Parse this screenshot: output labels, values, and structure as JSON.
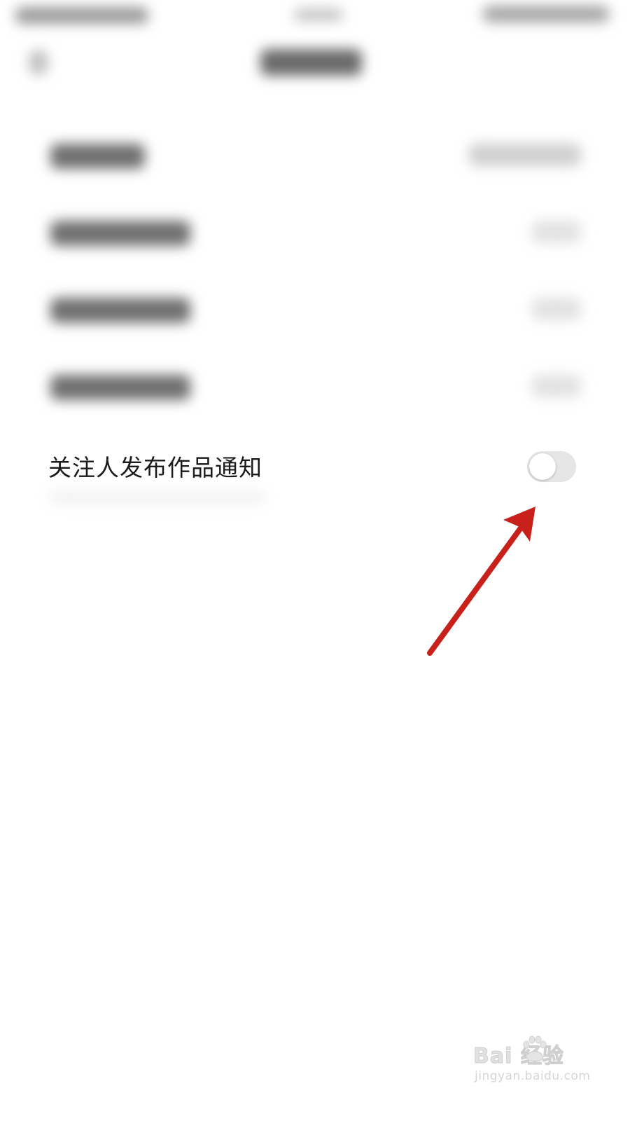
{
  "settings": {
    "follow_post_notify": {
      "label": "关注人发布作品通知",
      "enabled": false
    }
  },
  "watermark": {
    "logo_text": "Bai  经验",
    "site_text": "jingyan.baidu.com"
  },
  "annotation": {
    "color": "#c8201a",
    "icon": "arrow-icon"
  },
  "colors": {
    "toggle_off_track": "#e6e6e6",
    "toggle_knob": "#ffffff",
    "text_primary": "#1a1a1a"
  }
}
